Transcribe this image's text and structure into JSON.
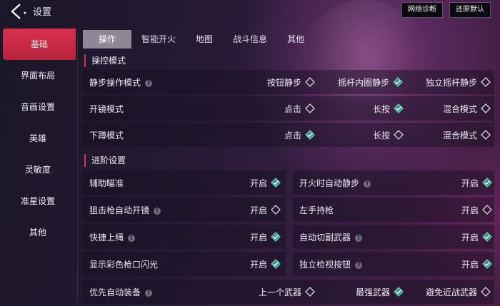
{
  "header": {
    "title": "设置",
    "network_btn": "网络诊断",
    "restore_btn": "还原默认"
  },
  "sidebar": {
    "items": [
      {
        "label": "基础"
      },
      {
        "label": "界面布局"
      },
      {
        "label": "音画设置"
      },
      {
        "label": "英雄"
      },
      {
        "label": "灵敏度"
      },
      {
        "label": "准星设置"
      },
      {
        "label": "其他"
      }
    ],
    "active_index": 0
  },
  "tabs": [
    {
      "label": "操作"
    },
    {
      "label": "智能开火"
    },
    {
      "label": "地图"
    },
    {
      "label": "战斗信息"
    },
    {
      "label": "其他"
    }
  ],
  "sections": {
    "control": {
      "title": "操控模式",
      "rows": [
        {
          "label": "静步操作模式",
          "has_help": true,
          "help_glyph": "?",
          "options": [
            {
              "text": "按钮静步",
              "checked": false
            },
            {
              "text": "摇杆内圈静步",
              "checked": true
            },
            {
              "text": "独立摇杆静步",
              "checked": false
            }
          ]
        },
        {
          "label": "开镜模式",
          "has_help": false,
          "options": [
            {
              "text": "点击",
              "checked": false
            },
            {
              "text": "长按",
              "checked": true
            },
            {
              "text": "混合模式",
              "checked": false
            }
          ]
        },
        {
          "label": "下蹲模式",
          "has_help": false,
          "options": [
            {
              "text": "点击",
              "checked": true
            },
            {
              "text": "长按",
              "checked": false
            },
            {
              "text": "混合模式",
              "checked": false
            }
          ]
        }
      ]
    },
    "advanced": {
      "title": "进阶设置",
      "left": [
        {
          "label": "辅助瞄准",
          "help_glyph": "",
          "value": "开启",
          "checked": true
        },
        {
          "label": "狙击枪自动开镜",
          "help_glyph": "!",
          "value": "开启",
          "checked": false
        },
        {
          "label": "快捷上绳",
          "help_glyph": "!",
          "value": "开启",
          "checked": true
        },
        {
          "label": "显示彩色枪口闪光",
          "help_glyph": "",
          "value": "开启",
          "checked": true
        }
      ],
      "right": [
        {
          "label": "开火时自动静步",
          "help_glyph": "!",
          "value": "开启",
          "checked": true
        },
        {
          "label": "左手持枪",
          "help_glyph": "",
          "value": "开启",
          "checked": false
        },
        {
          "label": "自动切副武器",
          "help_glyph": "!",
          "value": "开启",
          "checked": true
        },
        {
          "label": "独立检视按钮",
          "help_glyph": "?",
          "value": "开启",
          "checked": true
        }
      ],
      "bottom": {
        "label": "优先自动装备",
        "help_glyph": "!",
        "options": [
          {
            "text": "上一个武器",
            "checked": false
          },
          {
            "text": "最强武器",
            "checked": true
          },
          {
            "text": "避免近战武器",
            "checked": false
          }
        ]
      }
    }
  },
  "colors": {
    "accent_red": "#d9304c",
    "check_teal": "#5fd0b8",
    "tab_active": "#8d8796"
  },
  "icons": {
    "back": "chevron-left-icon",
    "checked": "checked-box-icon",
    "unchecked": "unchecked-box-icon",
    "help": "help-icon",
    "info": "info-icon"
  }
}
